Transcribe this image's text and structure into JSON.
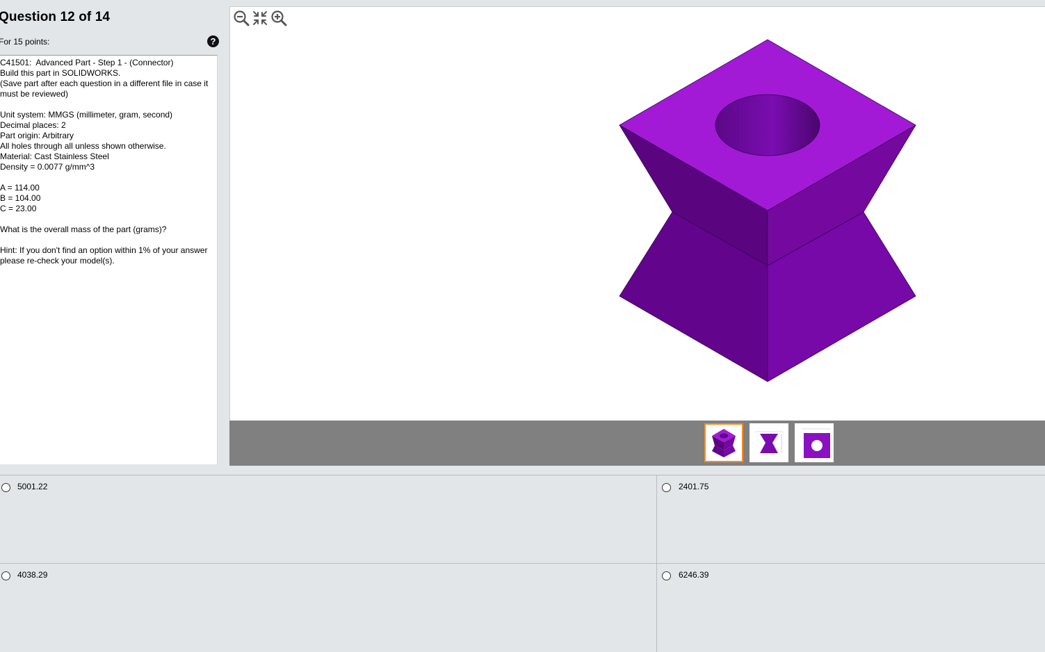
{
  "header": {
    "title": "Question 12 of 14",
    "points": "For 15 points:",
    "help_icon": "question-mark-icon",
    "help_symbol": "?"
  },
  "question": {
    "text": "C41501:  Advanced Part - Step 1 - (Connector)\nBuild this part in SOLIDWORKS.\n(Save part after each question in a different file in case it\nmust be reviewed)\n\nUnit system: MMGS (millimeter, gram, second)\nDecimal places: 2\nPart origin: Arbitrary\nAll holes through all unless shown otherwise.\nMaterial: Cast Stainless Steel\nDensity = 0.0077 g/mm^3\n\nA = 114.00\nB = 104.00\nC = 23.00\n\nWhat is the overall mass of the part (grams)?\n\nHint: If you don't find an option within 1% of your answer\nplease re-check your model(s)."
  },
  "viewer": {
    "toolbar": [
      "zoom-out-icon",
      "fit-to-window-icon",
      "zoom-in-icon"
    ],
    "model_color": "#a21ad6",
    "thumbnails": [
      {
        "name": "isometric-view-thumbnail",
        "selected": true
      },
      {
        "name": "front-view-thumbnail",
        "selected": false
      },
      {
        "name": "top-view-thumbnail",
        "selected": false
      }
    ],
    "selection_color": "#ff8c1a"
  },
  "answers": {
    "options": [
      "5001.22",
      "2401.75",
      "4038.29",
      "6246.39"
    ],
    "selected": null
  }
}
